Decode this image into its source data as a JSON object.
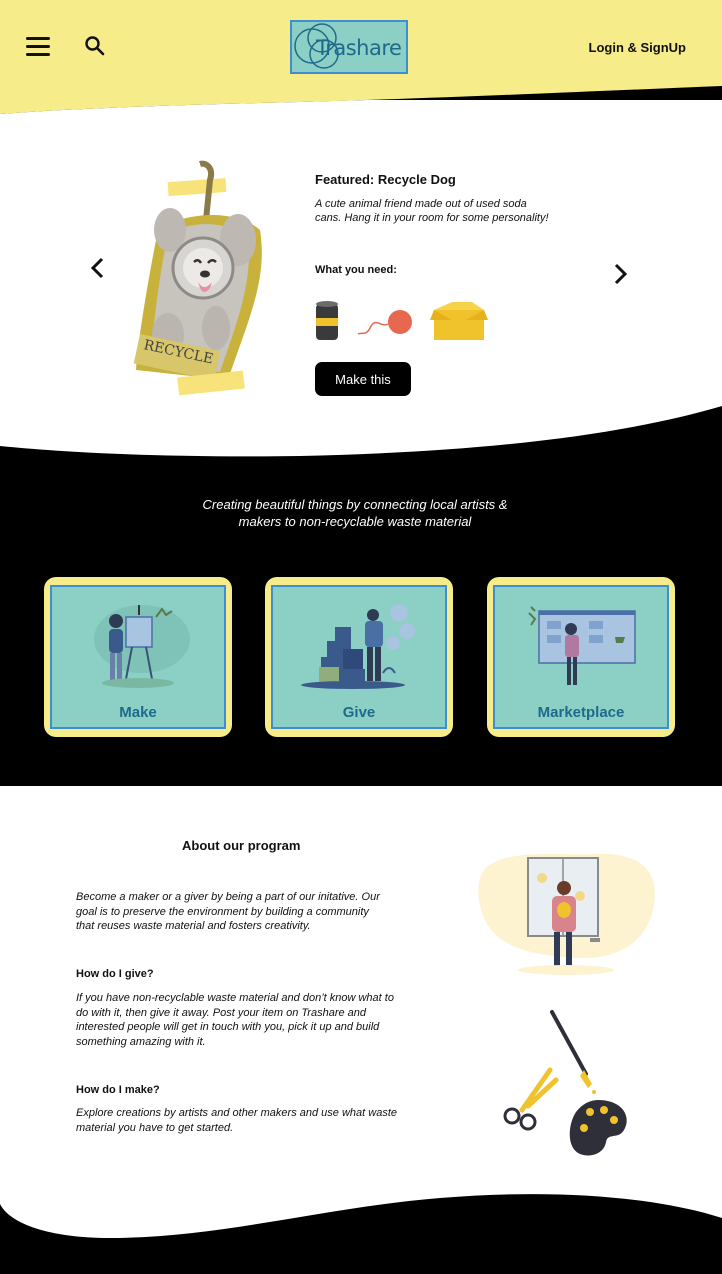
{
  "header": {
    "logo_text": "Trashare",
    "login_label": "Login & SignUp"
  },
  "featured": {
    "title": "Featured: Recycle Dog",
    "description": "A cute animal friend made out of used soda cans. Hang it in your room for some personality!",
    "need_label": "What you need:",
    "need_items": [
      "soda-can-icon",
      "yarn-ball-icon",
      "box-icon"
    ],
    "button_label": "Make this",
    "tag_text": "RECYCLE"
  },
  "tagline": {
    "line1": "Creating beautiful things by connecting local artists &",
    "line2": "makers to non-recyclable waste material"
  },
  "cards": [
    {
      "label": "Make"
    },
    {
      "label": "Give"
    },
    {
      "label": "Marketplace"
    }
  ],
  "about": {
    "title": "About our program",
    "intro_lines": [
      "Become a maker or a giver by being a part of our initative. Our",
      "goal is to preserve the environment by building a community",
      "that reuses waste material and fosters creativity."
    ],
    "give_heading": "How do I give?",
    "give_lines": [
      "If you have non-recyclable waste material and don’t know what to",
      "do with it, then give it away. Post your item on Trashare and",
      "interested people will get in touch with you, pick it up and build",
      "something amazing with it."
    ],
    "make_heading": "How do I make?",
    "make_lines": [
      "Explore creations by artists and other makers and use what waste",
      "material you have to get started."
    ]
  },
  "colors": {
    "yellow": "#f7ec8a",
    "teal": "#8ccfc4",
    "blue_border": "#3e8fd1",
    "label_blue": "#1e6a8c",
    "black": "#000000"
  }
}
